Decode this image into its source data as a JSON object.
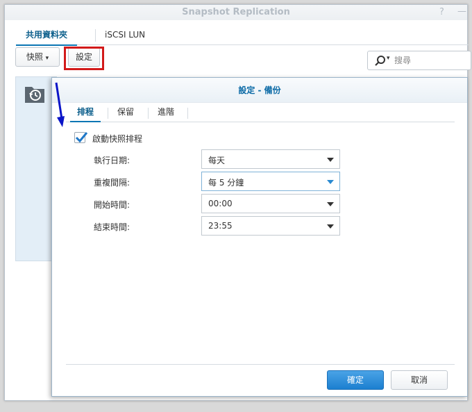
{
  "app": {
    "title": "Snapshot Replication",
    "help_glyph": "?",
    "minimize_glyph": "—"
  },
  "main_tabs": [
    {
      "label": "共用資料夾",
      "active": true
    },
    {
      "label": "iSCSI LUN",
      "active": false
    }
  ],
  "toolbar": {
    "snapshot_label": "快照",
    "snapshot_caret": "▾",
    "settings_label": "設定",
    "search_caret": "▾",
    "search_placeholder": "搜尋"
  },
  "dialog": {
    "title": "設定 - 備份",
    "tabs": [
      {
        "label": "排程",
        "active": true
      },
      {
        "label": "保留",
        "active": false
      },
      {
        "label": "進階",
        "active": false
      }
    ],
    "enable_schedule": {
      "label": "啟動快照排程",
      "checked": true
    },
    "fields": [
      {
        "label": "執行日期:",
        "value": "每天"
      },
      {
        "label": "重複間隔:",
        "value": "每 5 分鐘"
      },
      {
        "label": "開始時間:",
        "value": "00:00"
      },
      {
        "label": "結束時間:",
        "value": "23:55"
      }
    ],
    "ok_label": "確定",
    "cancel_label": "取消"
  },
  "colors": {
    "accent": "#0b6aa6",
    "primary_button": "#1c7fd0",
    "highlight": "#d21a1a",
    "annotation_arrow": "#0a14c8"
  },
  "icons": [
    "search-icon",
    "snapshot-folder-icon",
    "checkmark-icon",
    "chevron-down-icon",
    "annotation-arrow-icon"
  ]
}
